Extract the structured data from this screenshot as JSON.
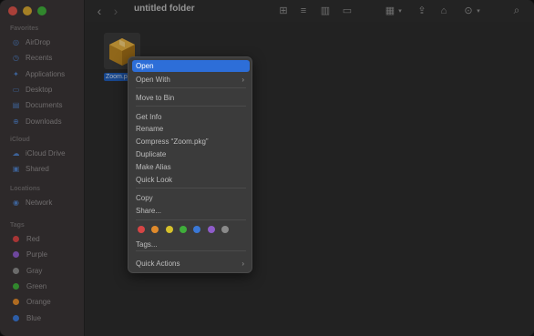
{
  "window": {
    "title": "untitled folder"
  },
  "sidebar": {
    "sections": [
      {
        "heading": "Favorites",
        "items": [
          {
            "label": "AirDrop",
            "icon": "airdrop-icon",
            "glyph": "◎"
          },
          {
            "label": "Recents",
            "icon": "clock-icon",
            "glyph": "◷"
          },
          {
            "label": "Applications",
            "icon": "applications-icon",
            "glyph": "✦"
          },
          {
            "label": "Desktop",
            "icon": "desktop-icon",
            "glyph": "▭"
          },
          {
            "label": "Documents",
            "icon": "document-icon",
            "glyph": "▤"
          },
          {
            "label": "Downloads",
            "icon": "download-icon",
            "glyph": "⊕"
          }
        ]
      },
      {
        "heading": "iCloud",
        "items": [
          {
            "label": "iCloud Drive",
            "icon": "cloud-icon",
            "glyph": "☁"
          },
          {
            "label": "Shared",
            "icon": "shared-folder-icon",
            "glyph": "▣"
          }
        ]
      },
      {
        "heading": "Locations",
        "items": [
          {
            "label": "Network",
            "icon": "network-icon",
            "glyph": "◉"
          }
        ]
      },
      {
        "heading": "Tags",
        "items": [
          {
            "label": "Red",
            "color": "#d64545"
          },
          {
            "label": "Purple",
            "color": "#8e5cc9"
          },
          {
            "label": "Gray",
            "color": "#8a8a8a"
          },
          {
            "label": "Green",
            "color": "#3fae3a"
          },
          {
            "label": "Orange",
            "color": "#e08a2b"
          },
          {
            "label": "Blue",
            "color": "#3a78d6"
          }
        ]
      }
    ]
  },
  "toolbar": {
    "back_glyph": "‹",
    "forward_glyph": "›",
    "view_icons": [
      "⊞",
      "≡",
      "▥",
      "▭"
    ],
    "group_glyph": "▦",
    "share_glyph": "⇪",
    "tag_glyph": "⌂",
    "action_glyph": "⊙",
    "search_glyph": "⌕"
  },
  "content": {
    "file": {
      "label": "Zoom.pkg"
    }
  },
  "context_menu": {
    "items": [
      {
        "label": "Open",
        "highlighted": true,
        "submenu": false
      },
      {
        "label": "Open With",
        "submenu": true
      },
      {
        "label": "Move to Bin",
        "submenu": false
      },
      {
        "label": "Get Info",
        "submenu": false
      },
      {
        "label": "Rename",
        "submenu": false
      },
      {
        "label": "Compress “Zoom.pkg”",
        "submenu": false
      },
      {
        "label": "Duplicate",
        "submenu": false
      },
      {
        "label": "Make Alias",
        "submenu": false
      },
      {
        "label": "Quick Look",
        "submenu": false
      },
      {
        "label": "Copy",
        "submenu": false
      },
      {
        "label": "Share...",
        "submenu": false
      },
      {
        "label": "Tags...",
        "submenu": false
      },
      {
        "label": "Quick Actions",
        "submenu": true
      }
    ],
    "tag_colors": [
      "#d64545",
      "#e08a2b",
      "#d6c12b",
      "#3fae3a",
      "#3a78d6",
      "#8e5cc9",
      "#8a8a8a"
    ],
    "submenu_glyph": "›"
  },
  "colors": {
    "accent": "#2d6ed8",
    "selection": "#1f5bb5"
  }
}
